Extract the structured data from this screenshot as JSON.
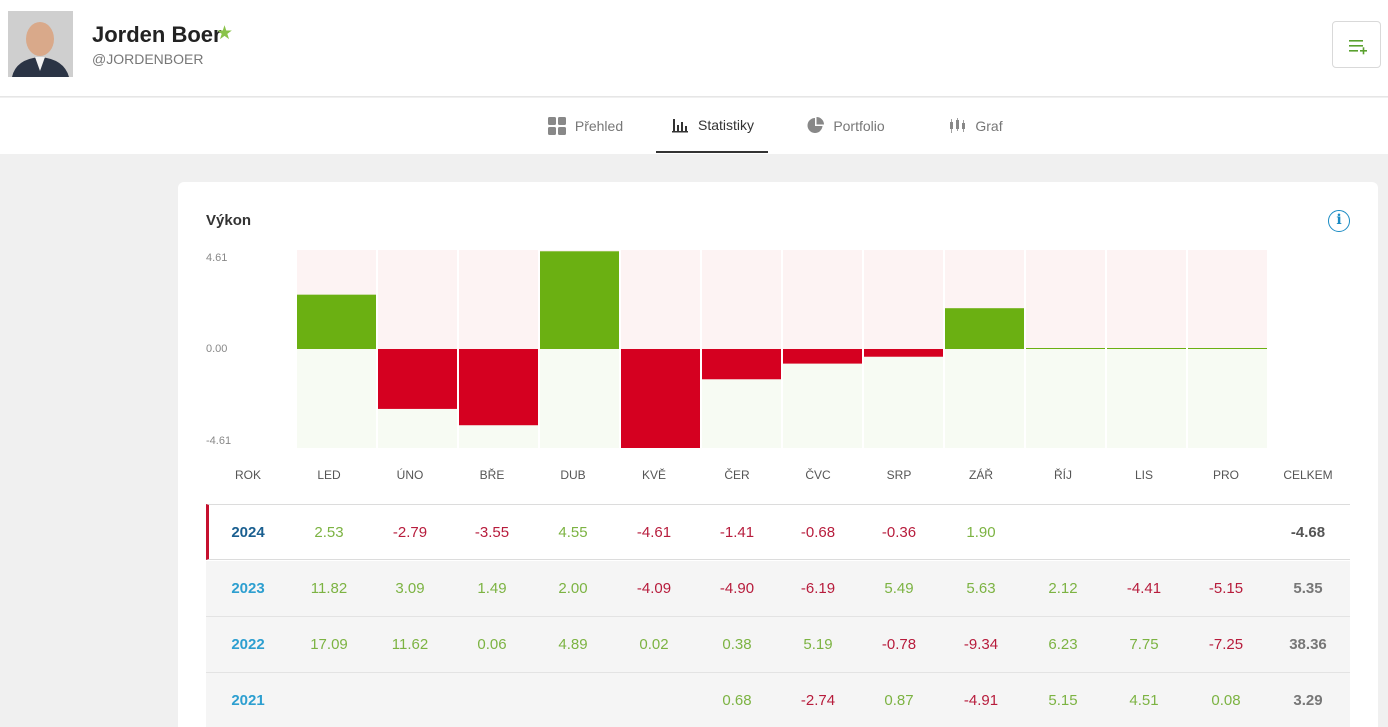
{
  "profile": {
    "name": "Jorden Boer",
    "handle": "@JORDENBOER",
    "star_icon": "star-icon",
    "menu_icon": "list-add-icon"
  },
  "tabs": [
    {
      "label": "Přehled",
      "icon": "grid-icon",
      "active": false
    },
    {
      "label": "Statistiky",
      "icon": "bar-chart-icon",
      "active": true
    },
    {
      "label": "Portfolio",
      "icon": "pie-chart-icon",
      "active": false
    },
    {
      "label": "Graf",
      "icon": "candlestick-icon",
      "active": false
    }
  ],
  "performance": {
    "title": "Výkon",
    "info_icon": "info-icon",
    "axis": {
      "max": "4.61",
      "zero": "0.00",
      "min": "-4.61"
    },
    "colors": {
      "positive": "#6bb012",
      "negative": "#d50020",
      "pos_bg": "#f7fbf3",
      "neg_bg": "#fdf3f3"
    }
  },
  "chart_data": {
    "type": "bar",
    "categories": [
      "LED",
      "ÚNO",
      "BŘE",
      "DUB",
      "KVĚ",
      "ČER",
      "ČVC",
      "SRP",
      "ZÁŘ",
      "ŘÍJ",
      "LIS",
      "PRO"
    ],
    "values": [
      2.53,
      -2.79,
      -3.55,
      4.55,
      -4.61,
      -1.41,
      -0.68,
      -0.36,
      1.9,
      0,
      0,
      0
    ],
    "ylim": [
      -4.61,
      4.61
    ],
    "ticks": [
      "4.61",
      "0.00",
      "-4.61"
    ],
    "grid": false,
    "legend": "none"
  },
  "table": {
    "headers": [
      "ROK",
      "LED",
      "ÚNO",
      "BŘE",
      "DUB",
      "KVĚ",
      "ČER",
      "ČVC",
      "SRP",
      "ZÁŘ",
      "ŘÍJ",
      "LIS",
      "PRO",
      "CELKEM"
    ],
    "rows": [
      {
        "year": "2024",
        "months": [
          "2.53",
          "-2.79",
          "-3.55",
          "4.55",
          "-4.61",
          "-1.41",
          "-0.68",
          "-0.36",
          "1.90",
          "",
          "",
          ""
        ],
        "total": "-4.68"
      },
      {
        "year": "2023",
        "months": [
          "11.82",
          "3.09",
          "1.49",
          "2.00",
          "-4.09",
          "-4.90",
          "-6.19",
          "5.49",
          "5.63",
          "2.12",
          "-4.41",
          "-5.15"
        ],
        "total": "5.35"
      },
      {
        "year": "2022",
        "months": [
          "17.09",
          "11.62",
          "0.06",
          "4.89",
          "0.02",
          "0.38",
          "5.19",
          "-0.78",
          "-9.34",
          "6.23",
          "7.75",
          "-7.25"
        ],
        "total": "38.36"
      },
      {
        "year": "2021",
        "months": [
          "",
          "",
          "",
          "",
          "",
          "0.68",
          "-2.74",
          "0.87",
          "-4.91",
          "5.15",
          "4.51",
          "0.08"
        ],
        "total": "3.29"
      }
    ]
  }
}
